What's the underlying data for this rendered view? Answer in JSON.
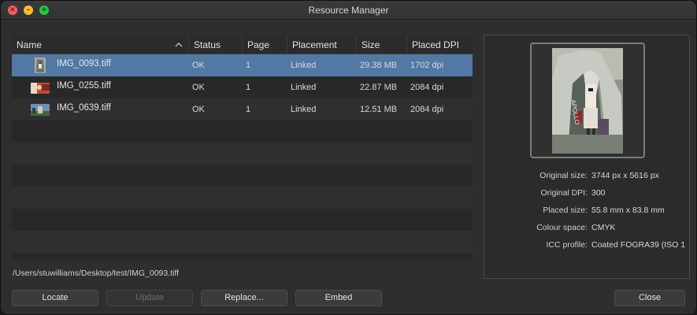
{
  "window": {
    "title": "Resource Manager"
  },
  "table": {
    "columns": [
      "Name",
      "Status",
      "Page",
      "Placement",
      "Size",
      "Placed DPI"
    ],
    "rows": [
      {
        "name": "IMG_0093.tiff",
        "status": "OK",
        "page": "1",
        "placement": "Linked",
        "size": "29.38 MB",
        "dpi": "1702 dpi",
        "selected": true
      },
      {
        "name": "IMG_0255.tiff",
        "status": "OK",
        "page": "1",
        "placement": "Linked",
        "size": "22.87 MB",
        "dpi": "2084 dpi",
        "selected": false
      },
      {
        "name": "IMG_0639.tiff",
        "status": "OK",
        "page": "1",
        "placement": "Linked",
        "size": "12.51 MB",
        "dpi": "2084 dpi",
        "selected": false
      }
    ],
    "sort_icon": "chevron-up-icon"
  },
  "path": "/Users/stuwilliams/Desktop/test/IMG_0093.tiff",
  "details": {
    "original_size_label": "Original size:",
    "original_size": "3744 px x 5616 px",
    "original_dpi_label": "Original DPI:",
    "original_dpi": "300",
    "placed_size_label": "Placed size:",
    "placed_size": "55.8 mm x 83.8 mm",
    "colour_space_label": "Colour space:",
    "colour_space": "CMYK",
    "icc_profile_label": "ICC profile:",
    "icc_profile": "Coated FOGRA39 (ISO 1"
  },
  "buttons": {
    "locate": "Locate",
    "update": "Update",
    "replace": "Replace...",
    "embed": "Embed",
    "close": "Close"
  },
  "colors": {
    "selection": "#5179a4",
    "close_light": "#fe5f57",
    "minimize_light": "#febc2e",
    "zoom_light": "#28c840"
  }
}
